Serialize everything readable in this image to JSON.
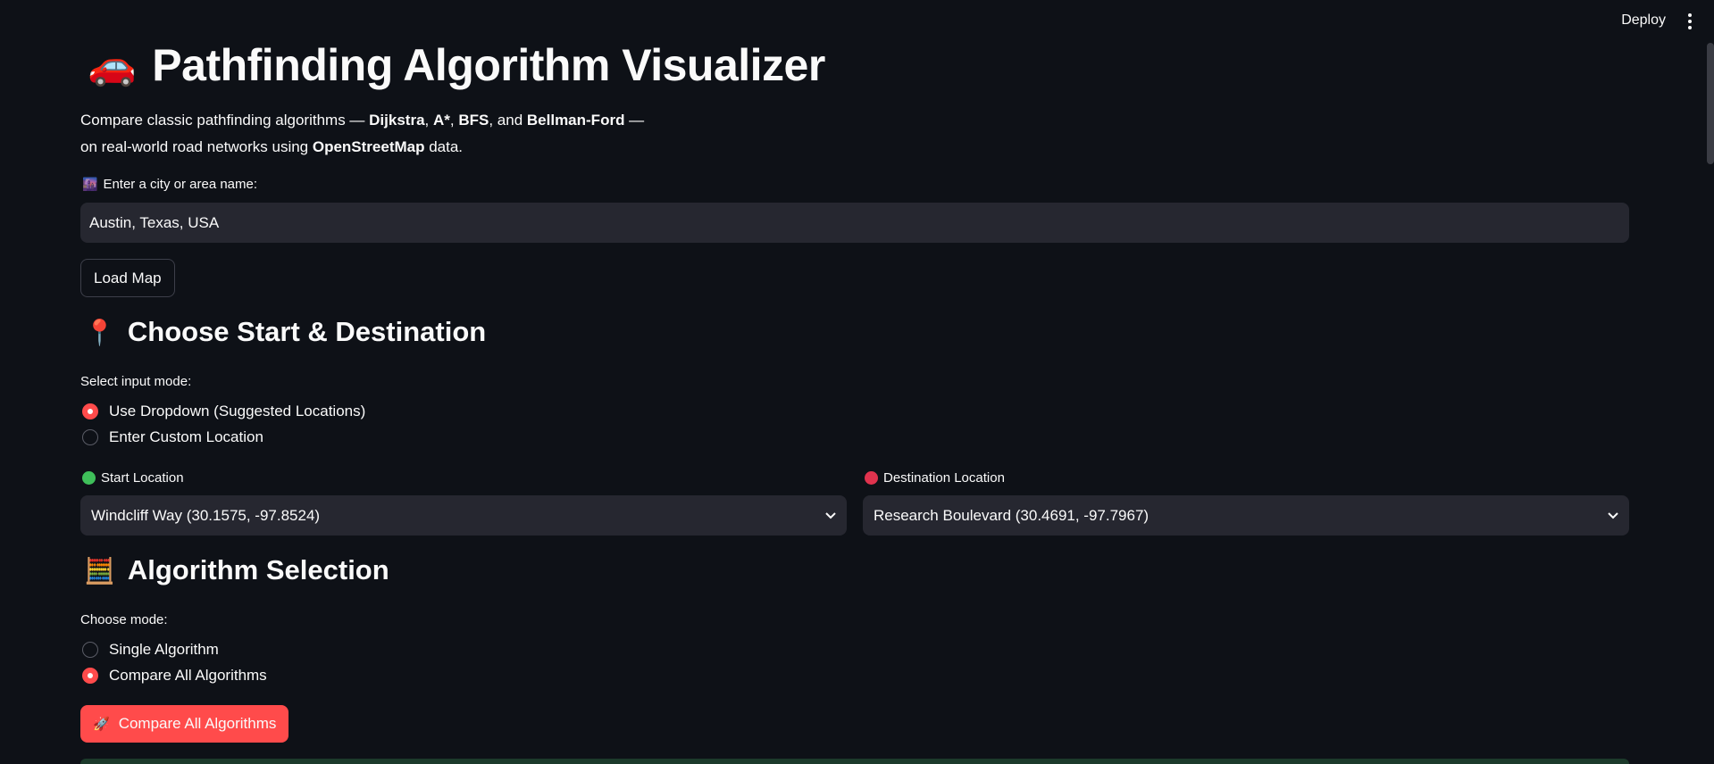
{
  "header": {
    "deploy_label": "Deploy"
  },
  "title": {
    "emoji": "🚗",
    "text": "Pathfinding Algorithm Visualizer"
  },
  "intro": {
    "p1": "Compare classic pathfinding algorithms — ",
    "a1": "Dijkstra",
    "sep1": ", ",
    "a2": "A*",
    "sep2": ", ",
    "a3": "BFS",
    "sep3": ", and ",
    "a4": "Bellman-Ford",
    "tail1": " —",
    "p2": "on real-world road networks using ",
    "source": "OpenStreetMap",
    "tail2": " data."
  },
  "city": {
    "emoji": "🌆",
    "label": "Enter a city or area name:",
    "value": "Austin, Texas, USA"
  },
  "load_button": "Load Map",
  "route": {
    "emoji": "📍",
    "heading": "Choose Start & Destination",
    "mode_label": "Select input mode:",
    "options": [
      "Use Dropdown (Suggested Locations)",
      "Enter Custom Location"
    ],
    "selected_index": 0,
    "start": {
      "label": "Start Location",
      "value": "Windcliff Way (30.1575, -97.8524)",
      "color": "#3fbf5a"
    },
    "dest": {
      "label": "Destination Location",
      "value": "Research Boulevard (30.4691, -97.7967)",
      "color": "#e0334e"
    }
  },
  "algo": {
    "emoji": "🧮",
    "heading": "Algorithm Selection",
    "mode_label": "Choose mode:",
    "options": [
      "Single Algorithm",
      "Compare All Algorithms"
    ],
    "selected_index": 1,
    "button_emoji": "🚀",
    "button_label": "Compare All Algorithms"
  },
  "colors": {
    "accent": "#ff4b4b",
    "background": "#0e1117",
    "input_bg": "#262730"
  }
}
